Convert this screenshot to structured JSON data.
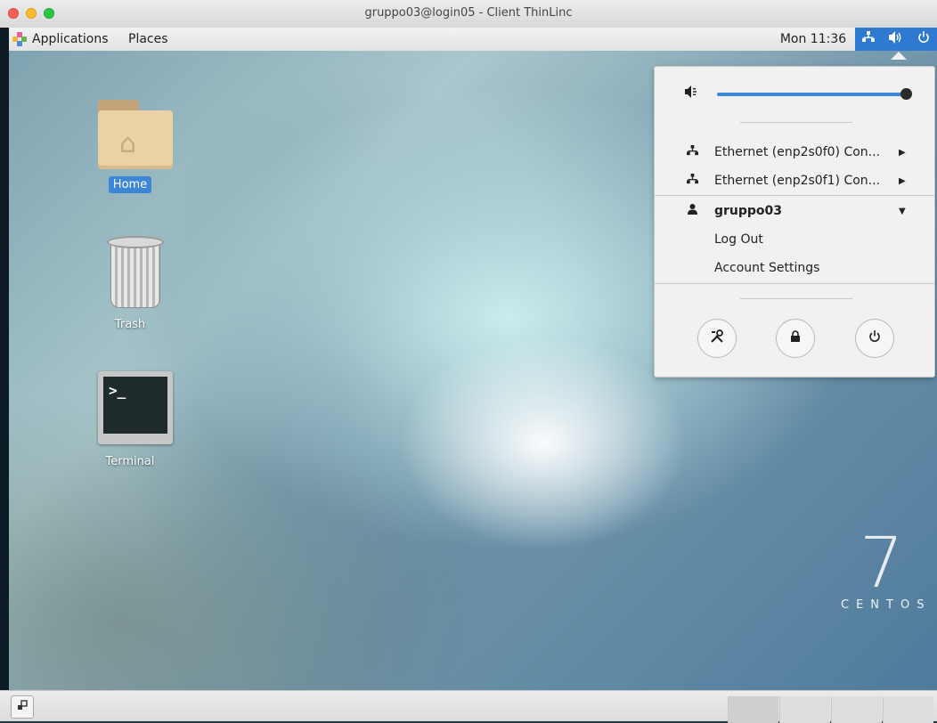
{
  "window": {
    "title": "gruppo03@login05 - Client ThinLinc"
  },
  "topbar": {
    "applications_label": "Applications",
    "places_label": "Places",
    "clock": "Mon 11:36",
    "tray_icons": [
      "network-icon",
      "volume-icon",
      "power-icon"
    ]
  },
  "desktop": {
    "icons": [
      {
        "label": "Home",
        "selected": true
      },
      {
        "label": "Trash",
        "selected": false
      },
      {
        "label": "Terminal",
        "selected": false
      }
    ],
    "terminal_prompt": ">_",
    "watermark": {
      "number": "7",
      "word": "CENTOS"
    }
  },
  "system_menu": {
    "volume_level": 1.0,
    "network_items": [
      {
        "label": "Ethernet (enp2s0f0) Con..."
      },
      {
        "label": "Ethernet (enp2s0f1) Con..."
      }
    ],
    "user": {
      "name": "gruppo03",
      "items": [
        {
          "label": "Log Out"
        },
        {
          "label": "Account Settings"
        }
      ]
    },
    "buttons": [
      "settings-icon",
      "lock-icon",
      "power-icon"
    ]
  },
  "bottombar": {
    "workspace_count": 4
  },
  "colors": {
    "accent": "#3b86d6",
    "tray": "#2d7ad0"
  }
}
